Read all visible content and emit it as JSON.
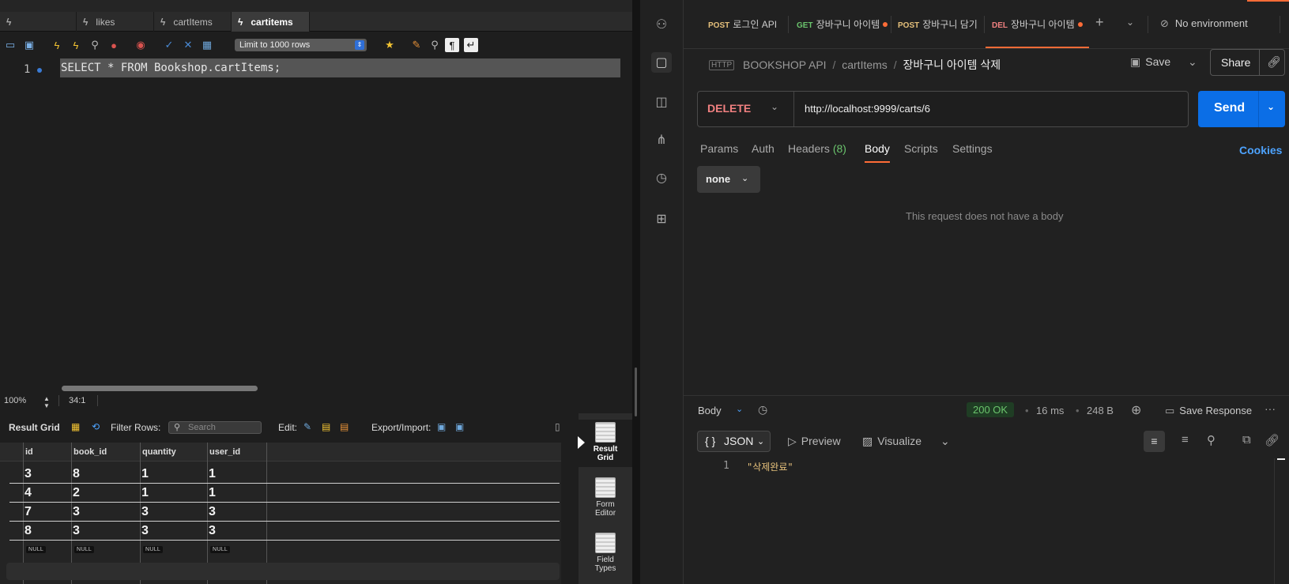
{
  "workbench": {
    "tabs": [
      {
        "label": ""
      },
      {
        "label": "likes"
      },
      {
        "label": "cartItems"
      },
      {
        "label": "cartitems"
      }
    ],
    "limit_rows": "Limit to 1000 rows",
    "editor": {
      "line_number": "1",
      "sql": "SELECT * FROM Bookshop.cartItems;"
    },
    "status": {
      "zoom": "100%",
      "cursor": "34:1"
    },
    "result": {
      "title": "Result Grid",
      "filter_label": "Filter Rows:",
      "search_placeholder": "Search",
      "edit_label": "Edit:",
      "export_label": "Export/Import:",
      "columns": [
        "id",
        "book_id",
        "quantity",
        "user_id"
      ],
      "rows": [
        [
          "3",
          "8",
          "1",
          "1"
        ],
        [
          "4",
          "2",
          "1",
          "1"
        ],
        [
          "7",
          "3",
          "3",
          "3"
        ],
        [
          "8",
          "3",
          "3",
          "3"
        ]
      ],
      "null_label": "NULL"
    },
    "side_panel": [
      {
        "line1": "Result",
        "line2": "Grid"
      },
      {
        "line1": "Form",
        "line2": "Editor"
      },
      {
        "line1": "Field",
        "line2": "Types"
      }
    ]
  },
  "postman": {
    "tabs": [
      {
        "method": "POST",
        "label": "로그인 API",
        "dirty": false
      },
      {
        "method": "GET",
        "label": "장바구니 아이템",
        "dirty": true
      },
      {
        "method": "POST",
        "label": "장바구니 담기",
        "dirty": false
      },
      {
        "method": "DEL",
        "label": "장바구니 아이템",
        "dirty": true
      }
    ],
    "environment": "No environment",
    "breadcrumb": {
      "badge": "HTTP",
      "collection": "BOOKSHOP API",
      "folder": "cartItems",
      "request": "장바구니 아이템 삭제"
    },
    "save_label": "Save",
    "share_label": "Share",
    "request": {
      "method": "DELETE",
      "url": "http://localhost:9999/carts/6"
    },
    "send_label": "Send",
    "req_tabs": {
      "params": "Params",
      "auth": "Auth",
      "headers": "Headers",
      "headers_count": "(8)",
      "body": "Body",
      "scripts": "Scripts",
      "settings": "Settings"
    },
    "cookies_label": "Cookies",
    "body_type": "none",
    "no_body_message": "This request does not have a body",
    "response": {
      "section_label": "Body",
      "status": "200 OK",
      "time": "16 ms",
      "size": "248 B",
      "save_response": "Save Response",
      "format": "JSON",
      "preview": "Preview",
      "visualize": "Visualize",
      "line": "1",
      "value": "\"삭제완료\""
    },
    "colors": {
      "accent": "#ff6c37",
      "send": "#0b6ee6",
      "delete": "#f08080",
      "ok": "#6bc46d"
    }
  }
}
